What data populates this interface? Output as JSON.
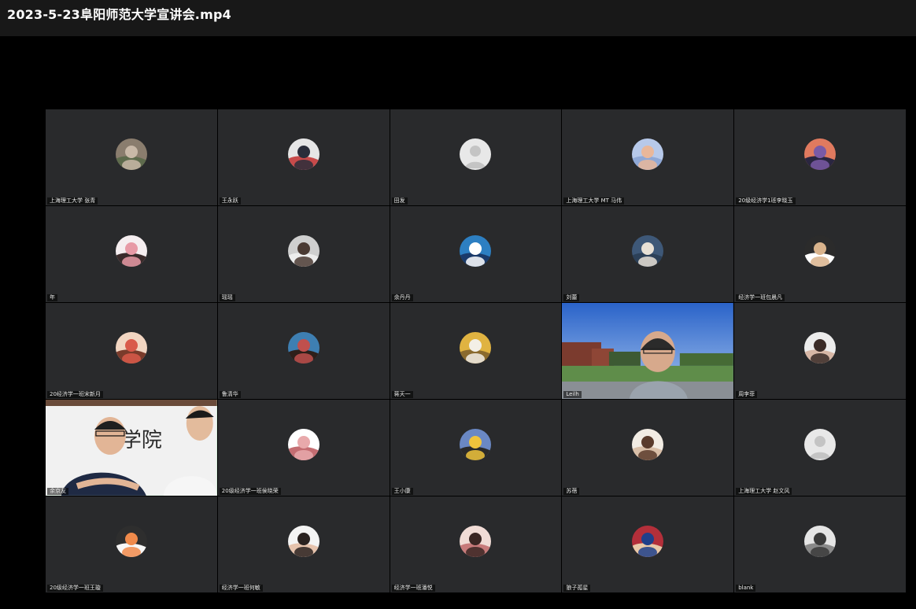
{
  "window": {
    "title": "2023-5-23阜阳师范大学宣讲会.mp4"
  },
  "participants": [
    {
      "name": "上海理工大学 张青",
      "avatar": "landscape-photo",
      "colors": [
        "#8a7d6e",
        "#c9b9a8",
        "#5e6b4d"
      ]
    },
    {
      "name": "王永跃",
      "avatar": "person-photo",
      "colors": [
        "#e6e6e6",
        "#2a2d3a",
        "#c84a4a"
      ]
    },
    {
      "name": "田发",
      "avatar": "default-avatar",
      "colors": [
        "#e8e8e8",
        "#c4c4c4",
        "#d8d8d8"
      ]
    },
    {
      "name": "上海理工大学 MT 马伟",
      "avatar": "sky-photo",
      "colors": [
        "#b7c9ea",
        "#e9b79a",
        "#8fa8d6"
      ]
    },
    {
      "name": "20级经济学1班李晓玉",
      "avatar": "sunset-photo",
      "colors": [
        "#e07a5f",
        "#7a5aa6",
        "#2a2640"
      ]
    },
    {
      "name": "年",
      "avatar": "anime-photo",
      "colors": [
        "#f5eef0",
        "#e79aa6",
        "#3a2b2b"
      ]
    },
    {
      "name": "瑶瑶",
      "avatar": "portrait-photo",
      "colors": [
        "#cfcfcf",
        "#4a3a33",
        "#ededed"
      ]
    },
    {
      "name": "余丹丹",
      "avatar": "blue-photo",
      "colors": [
        "#2d7fc2",
        "#ffffff",
        "#1a3a6a"
      ]
    },
    {
      "name": "刘蕾",
      "avatar": "dog-photo",
      "colors": [
        "#3e5878",
        "#e8e1d6",
        "#2c4058"
      ]
    },
    {
      "name": "经济学一班包晨凡",
      "avatar": "bear-photo",
      "colors": [
        "#2b2b2b",
        "#d9b38c",
        "#ffffff"
      ]
    },
    {
      "name": "20经济学一班宋新月",
      "avatar": "cartoon-photo",
      "colors": [
        "#f2d6c2",
        "#d95a4a",
        "#7a3b2b"
      ]
    },
    {
      "name": "鲁清华",
      "avatar": "cartoon2-photo",
      "colors": [
        "#3e7fb2",
        "#c0504d",
        "#2d1f1a"
      ]
    },
    {
      "name": "蒋天一",
      "avatar": "yellow-photo",
      "colors": [
        "#e0b341",
        "#f3efe6",
        "#8a6a2e"
      ]
    },
    {
      "name": "Leilh",
      "avatar": "video-campus",
      "colors": [
        "#3b7bd8",
        "#8cb4e8",
        "#5f8d4a"
      ]
    },
    {
      "name": "周李菲",
      "avatar": "girl-photo",
      "colors": [
        "#ececec",
        "#3a2b27",
        "#d7b7a6"
      ]
    },
    {
      "name": "余京友",
      "avatar": "video-speaker",
      "colors": [
        "#f1f1f1",
        "#1f2a44",
        "#e2b596"
      ]
    },
    {
      "name": "20级经济学一班侯晓荣",
      "avatar": "pig-photo",
      "colors": [
        "#ffffff",
        "#e8a9ab",
        "#c46d72"
      ]
    },
    {
      "name": "王小康",
      "avatar": "duck-photo",
      "colors": [
        "#6a88c4",
        "#f0c43c",
        "#2a2a2a"
      ]
    },
    {
      "name": "苏蓓",
      "avatar": "anime2-photo",
      "colors": [
        "#f2ece4",
        "#5a3b2c",
        "#d9bfa8"
      ]
    },
    {
      "name": "上海理工大学 赵文风",
      "avatar": "default-avatar",
      "colors": [
        "#e8e8e8",
        "#c4c4c4",
        "#d8d8d8"
      ]
    },
    {
      "name": "20级经济学一班王璇",
      "avatar": "dark-photo",
      "colors": [
        "#2e2e2e",
        "#f08a4b",
        "#f7f7f7"
      ]
    },
    {
      "name": "经济学一班何敏",
      "avatar": "woman-photo",
      "colors": [
        "#f4f4f4",
        "#2a2220",
        "#e6c3ad"
      ]
    },
    {
      "name": "经济学一班潘悦",
      "avatar": "girl2-photo",
      "colors": [
        "#f1dcd6",
        "#3a2623",
        "#c77a7a"
      ]
    },
    {
      "name": "狼子孤星",
      "avatar": "soccer-photo",
      "colors": [
        "#b32f3a",
        "#1f3f8a",
        "#e9c9a8"
      ]
    },
    {
      "name": "blank",
      "avatar": "car-photo",
      "colors": [
        "#e5e5e5",
        "#3a3a3a",
        "#8a8a8a"
      ]
    }
  ]
}
